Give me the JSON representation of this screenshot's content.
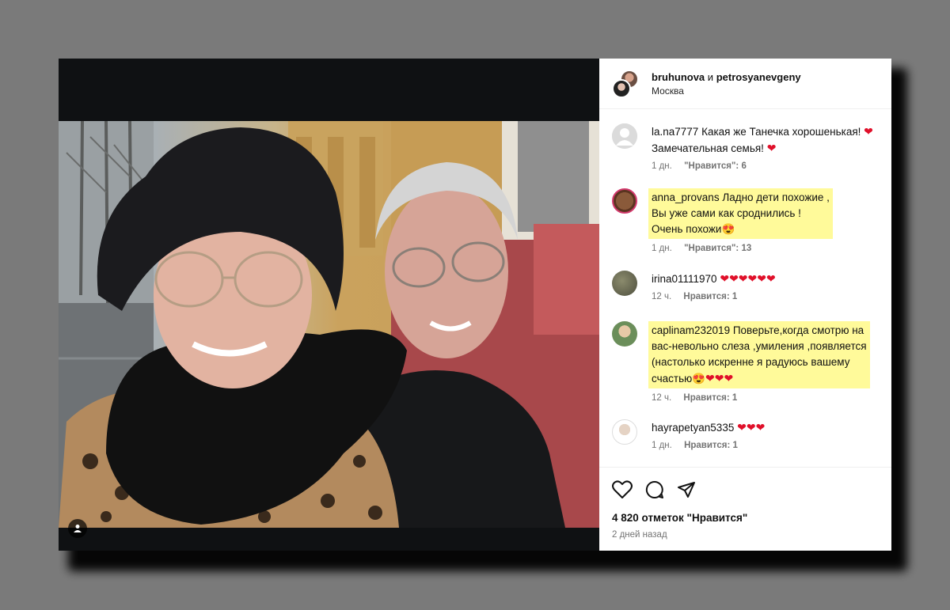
{
  "post": {
    "author1": "bruhunova",
    "joiner": "и",
    "author2": "petrosyanevgeny",
    "location": "Москва"
  },
  "comments": [
    {
      "user": "la.na7777",
      "text": "Какая же Танечка хорошенькая!",
      "text2": "Замечательная семья!",
      "age": "1 дн.",
      "likes": "\"Нравится\": 6"
    },
    {
      "user": "anna_provans",
      "text": "Ладно дети похожие ,",
      "text2": "Вы уже сами как сроднились !",
      "text3": "Очень похожи",
      "age": "1 дн.",
      "likes": "\"Нравится\": 13"
    },
    {
      "user": "irina01111970",
      "age": "12 ч.",
      "likes": "Нравится: 1"
    },
    {
      "user": "caplinam232019",
      "text": "Поверьте,когда смотрю на",
      "text2": "вас-невольно слеза ,умиления ,появляется",
      "text3": "(настолько искренне я радуюсь вашему",
      "text4": "счастью",
      "age": "12 ч.",
      "likes": "Нравится: 1"
    },
    {
      "user": "hayrapetyan5335",
      "age": "1 дн.",
      "likes": "Нравится: 1"
    }
  ],
  "footer": {
    "likes_count": "4 820 отметок \"Нравится\"",
    "time_ago": "2 дней назад"
  },
  "icons": {
    "like": "heart-outline-icon",
    "comment": "comment-bubble-icon",
    "share": "paper-plane-icon",
    "tag": "user-tag-icon"
  },
  "colors": {
    "highlight": "#fffa9a",
    "heart": "#e0102a",
    "meta": "#737373"
  }
}
